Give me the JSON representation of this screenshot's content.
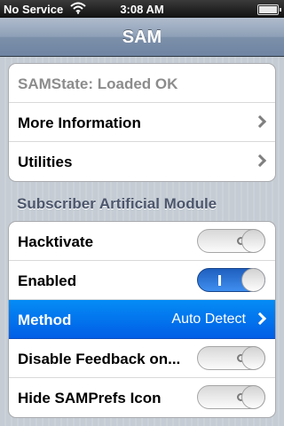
{
  "status_bar": {
    "carrier": "No Service",
    "time": "3:08 AM",
    "wifi_icon": "wifi-icon",
    "battery_icon": "battery-icon"
  },
  "nav": {
    "title": "SAM"
  },
  "group1": {
    "state_label": "SAMState: Loaded OK",
    "more_info_label": "More Information",
    "utilities_label": "Utilities"
  },
  "section": {
    "header": "Subscriber Artificial Module"
  },
  "group2": {
    "hacktivate_label": "Hacktivate",
    "hacktivate_on": false,
    "enabled_label": "Enabled",
    "enabled_on": true,
    "method_label": "Method",
    "method_value": "Auto Detect",
    "disable_feedback_label": "Disable Feedback on...",
    "disable_feedback_on": false,
    "hide_icon_label": "Hide SAMPrefs Icon",
    "hide_icon_on": false
  },
  "colors": {
    "navbar": "#7c90aa",
    "selected_row": "#015ee6",
    "switch_on": "#3f8ff0"
  }
}
